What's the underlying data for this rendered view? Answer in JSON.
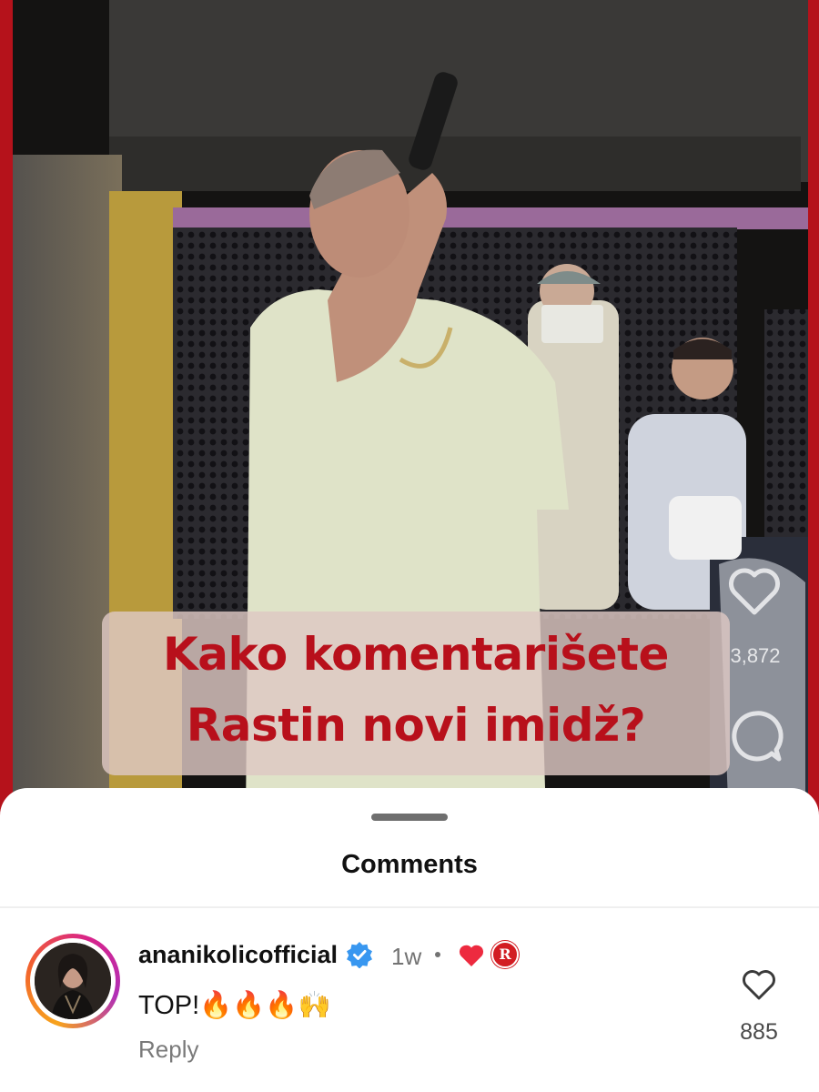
{
  "video": {
    "caption_line1": "Kako komentarišete",
    "caption_line2": "Rastin novi imidž?",
    "like_icon": "heart-outline-icon",
    "like_count": "3,872",
    "comment_icon": "comment-bubble-icon"
  },
  "sheet": {
    "title": "Comments"
  },
  "comments": [
    {
      "username": "ananikolicofficial",
      "verified_icon": "verified-badge-icon",
      "time": "1w",
      "creator_liked_icon": "red-heart-icon",
      "creator_badge": "R",
      "text": "TOP!🔥🔥🔥🙌",
      "reply_label": "Reply",
      "like_icon": "heart-outline-icon",
      "like_count": "885"
    }
  ],
  "colors": {
    "caption_text": "#b8101b",
    "accent_red": "#b5121b",
    "verified_blue": "#3897f0",
    "like_red": "#ed2a3f"
  }
}
